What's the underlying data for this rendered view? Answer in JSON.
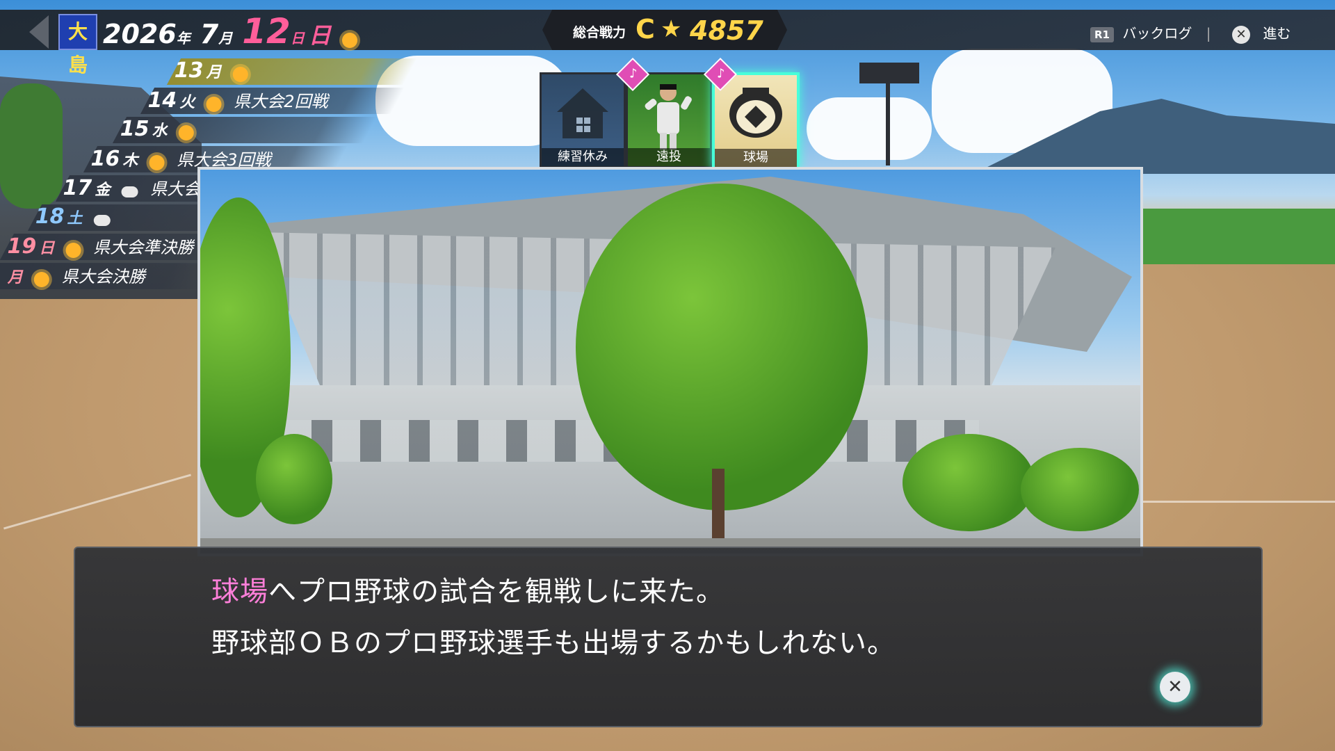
{
  "header": {
    "team": "大島",
    "year": "2026",
    "year_unit": "年",
    "month": "7",
    "month_unit": "月",
    "day": "12",
    "day_unit": "日",
    "weekday": "日"
  },
  "power": {
    "label": "総合戦力",
    "rank": "C",
    "star": "★",
    "value": "4857"
  },
  "hints": {
    "backlog_key": "R1",
    "backlog_label": "バックログ",
    "advance_label": "進む",
    "x_glyph": "✕"
  },
  "schedule": [
    {
      "day": "13",
      "weekday": "月",
      "weather": "sunny-icon",
      "event": ""
    },
    {
      "day": "14",
      "weekday": "火",
      "weather": "sunny-icon",
      "event": "県大会2回戦"
    },
    {
      "day": "15",
      "weekday": "水",
      "weather": "sunny-icon",
      "event": ""
    },
    {
      "day": "16",
      "weekday": "木",
      "weather": "sunny-icon",
      "event": "県大会3回戦"
    },
    {
      "day": "17",
      "weekday": "金",
      "weather": "cloudy-icon",
      "event": "県大会準々決勝"
    },
    {
      "day": "18",
      "weekday": "土",
      "weather": "cloudy-icon",
      "event": ""
    },
    {
      "day": "19",
      "weekday": "日",
      "weather": "sunny-icon",
      "event": "県大会準決勝"
    },
    {
      "day": "",
      "weekday": "月",
      "weather": "sunny-icon",
      "event": "県大会決勝"
    }
  ],
  "actions": [
    {
      "label": "練習休み",
      "icon": "house-icon"
    },
    {
      "label": "遠投",
      "icon": "pitcher-icon"
    },
    {
      "label": "球場",
      "icon": "stadium-icon"
    }
  ],
  "note_glyph": "♪",
  "dialog": {
    "line1_highlight": "球場",
    "line1_rest": "へプロ野球の試合を観戦しに来た。",
    "line2": "野球部ＯＢのプロ野球選手も出場するかもしれない。"
  },
  "colors": {
    "accent_pink": "#ff7fd9",
    "accent_gold": "#ffd54a",
    "select_glow": "#48ffd9"
  }
}
